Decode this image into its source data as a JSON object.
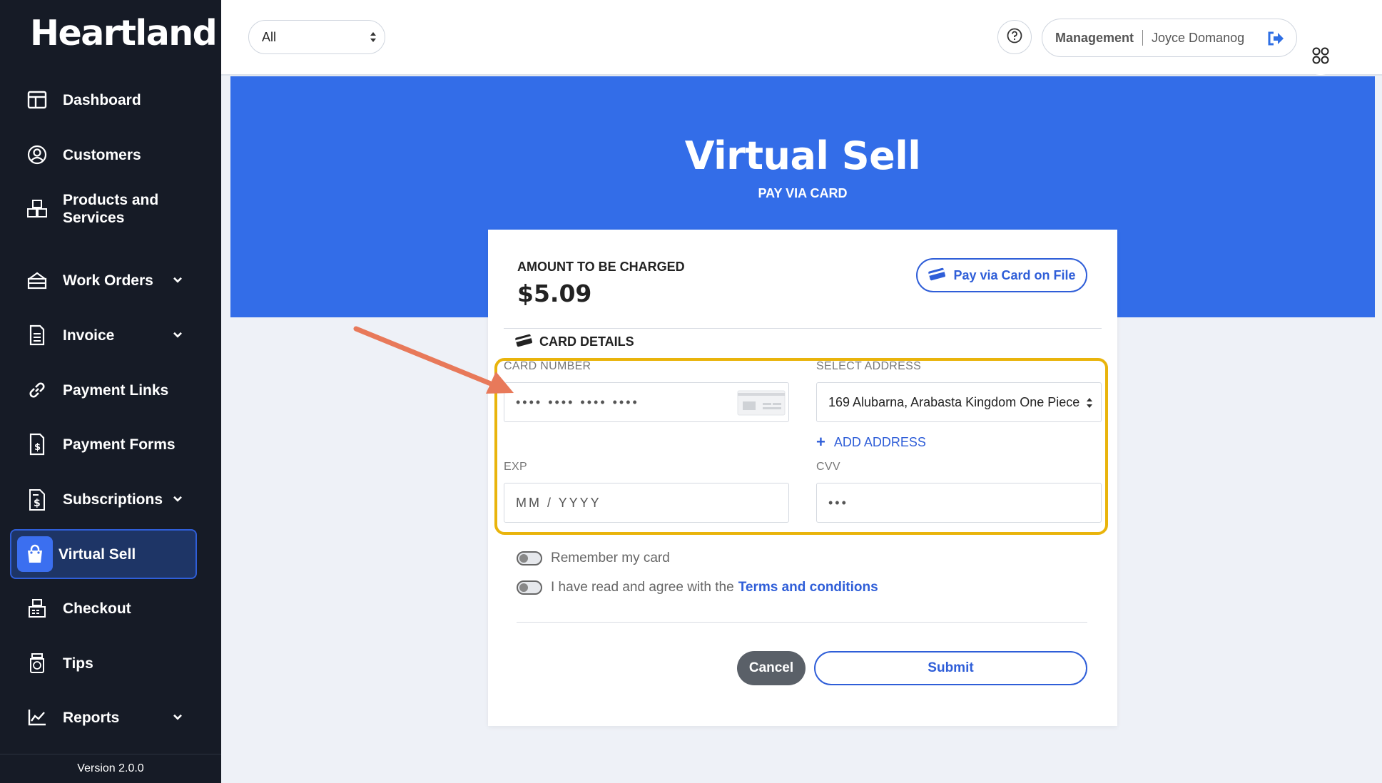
{
  "sidebar": {
    "brand": "Heartland",
    "items": [
      {
        "label": "Dashboard",
        "icon": "dashboard-icon"
      },
      {
        "label": "Customers",
        "icon": "customers-icon"
      },
      {
        "label": "Products and Services",
        "icon": "products-icon"
      },
      {
        "label": "Work Orders",
        "icon": "work-orders-icon",
        "expandable": true
      },
      {
        "label": "Invoice",
        "icon": "invoice-icon",
        "expandable": true
      },
      {
        "label": "Payment Links",
        "icon": "link-icon"
      },
      {
        "label": "Payment Forms",
        "icon": "payment-forms-icon"
      },
      {
        "label": "Subscriptions",
        "icon": "subscriptions-icon",
        "expandable": true
      },
      {
        "label": "Virtual Sell",
        "icon": "shopping-bag-icon",
        "active": true
      },
      {
        "label": "Checkout",
        "icon": "checkout-icon"
      },
      {
        "label": "Tips",
        "icon": "tips-icon"
      },
      {
        "label": "Reports",
        "icon": "reports-icon",
        "expandable": true
      }
    ],
    "version": "Version 2.0.0"
  },
  "topbar": {
    "filter_value": "All",
    "management_label": "Management",
    "user_name": "Joyce Domanog"
  },
  "hero": {
    "title": "Virtual Sell",
    "subtitle": "PAY VIA CARD"
  },
  "payment": {
    "amount_label": "AMOUNT TO BE CHARGED",
    "amount_value": "$5.09",
    "pay_on_file_label": "Pay via Card on File",
    "card_details_label": "CARD DETAILS",
    "card_number_label": "CARD NUMBER",
    "card_number_placeholder": "•••• •••• •••• ••••",
    "select_address_label": "SELECT ADDRESS",
    "selected_address": "169 Alubarna, Arabasta Kingdom One Piece",
    "add_address_label": "ADD ADDRESS",
    "exp_label": "EXP",
    "exp_placeholder": "MM / YYYY",
    "cvv_label": "CVV",
    "cvv_placeholder": "•••",
    "remember_label": "Remember my card",
    "terms_prefix": "I have read and agree with the",
    "terms_link": "Terms and conditions",
    "cancel_label": "Cancel",
    "submit_label": "Submit"
  },
  "colors": {
    "sidebar_bg": "#161b26",
    "accent": "#336de8",
    "highlight": "#e9b40c",
    "annotation_arrow": "#e8795a"
  }
}
